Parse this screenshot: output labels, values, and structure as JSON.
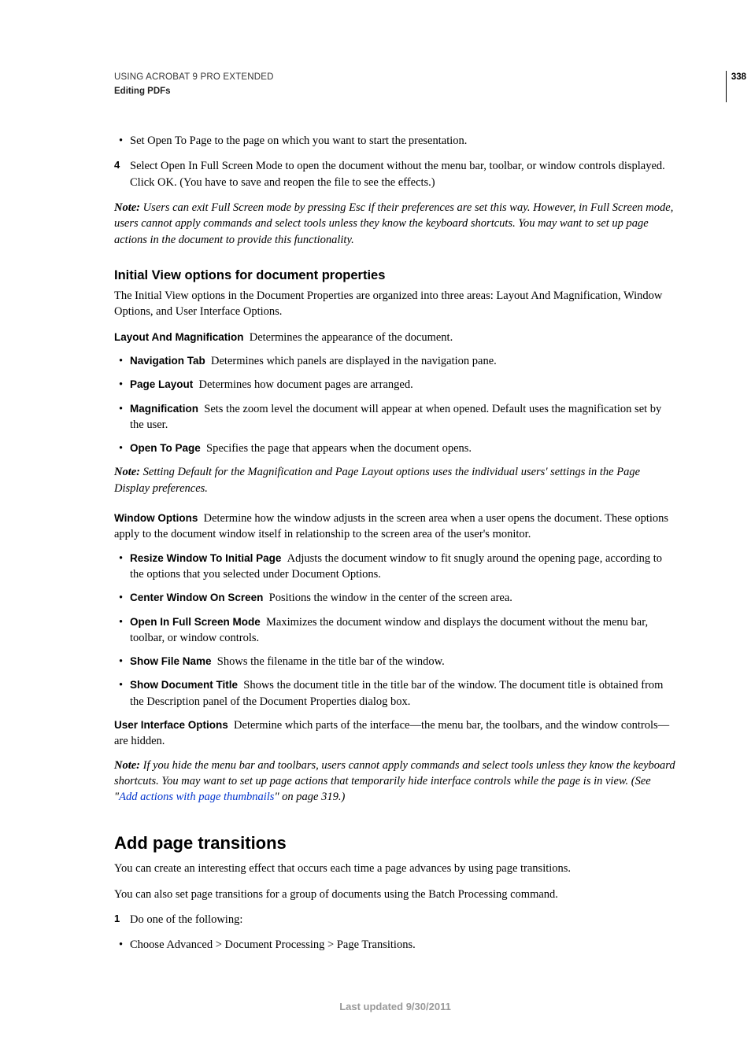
{
  "header": {
    "line1": "USING ACROBAT 9 PRO EXTENDED",
    "line2": "Editing PDFs",
    "page_number": "338"
  },
  "intro_list": {
    "bullet1": "Set Open To Page to the page on which you want to start the presentation.",
    "step4_marker": "4",
    "step4_text": "Select Open In Full Screen Mode to open the document without the menu bar, toolbar, or window controls displayed. Click OK. (You have to save and reopen the file to see the effects.)"
  },
  "note1": {
    "label": "Note:",
    "text": " Users can exit Full Screen mode by pressing Esc if their preferences are set this way. However, in Full Screen mode, users cannot apply commands and select tools unless they know the keyboard shortcuts. You may want to set up page actions in the document to provide this functionality."
  },
  "section1": {
    "heading": "Initial View options for document properties",
    "intro": "The Initial View options in the Document Properties are organized into three areas: Layout And Magnification, Window Options, and User Interface Options.",
    "layout_term": "Layout And Magnification",
    "layout_desc": "Determines the appearance of the document.",
    "nav_tab_term": "Navigation Tab",
    "nav_tab_desc": "Determines which panels are displayed in the navigation pane.",
    "page_layout_term": "Page Layout",
    "page_layout_desc": "Determines how document pages are arranged.",
    "mag_term": "Magnification",
    "mag_desc": "Sets the zoom level the document will appear at when opened. Default uses the magnification set by the user.",
    "open_to_term": "Open To Page",
    "open_to_desc": "Specifies the page that appears when the document opens.",
    "note2_label": "Note:",
    "note2_text": " Setting Default for the Magnification and Page Layout options uses the individual users' settings in the Page Display preferences.",
    "window_term": "Window Options",
    "window_desc": "Determine how the window adjusts in the screen area when a user opens the document. These options apply to the document window itself in relationship to the screen area of the user's monitor.",
    "resize_term": "Resize Window To Initial Page",
    "resize_desc": "Adjusts the document window to fit snugly around the opening page, according to the options that you selected under Document Options.",
    "center_term": "Center Window On Screen",
    "center_desc": "Positions the window in the center of the screen area.",
    "full_term": "Open In Full Screen Mode",
    "full_desc": "Maximizes the document window and displays the document without the menu bar, toolbar, or window controls.",
    "filename_term": "Show File Name",
    "filename_desc": "Shows the filename in the title bar of the window.",
    "doctitle_term": "Show Document Title",
    "doctitle_desc": "Shows the document title in the title bar of the window. The document title is obtained from the Description panel of the Document Properties dialog box.",
    "ui_term": "User Interface Options",
    "ui_desc": "Determine which parts of the interface—the menu bar, the toolbars, and the window controls—are hidden.",
    "note3_label": "Note:",
    "note3_pre": " If you hide the menu bar and toolbars, users cannot apply commands and select tools unless they know the keyboard shortcuts. You may want to set up page actions that temporarily hide interface controls while the page is in view. (See \"",
    "note3_link": "Add actions with page thumbnails",
    "note3_post": "\" on page 319.)"
  },
  "section2": {
    "heading": "Add page transitions",
    "p1": "You can create an interesting effect that occurs each time a page advances by using page transitions.",
    "p2": "You can also set page transitions for a group of documents using the Batch Processing command.",
    "step1_marker": "1",
    "step1_text": "Do one of the following:",
    "bullet_text": "Choose Advanced > Document Processing > Page Transitions."
  },
  "footer": "Last updated 9/30/2011"
}
